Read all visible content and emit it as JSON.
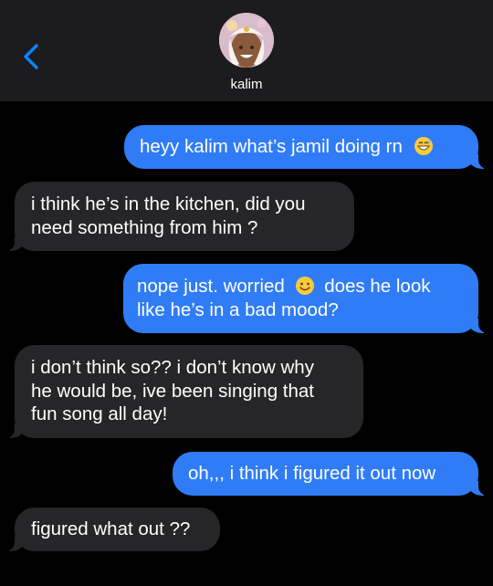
{
  "header": {
    "contact_name": "kalim",
    "back_icon": "chevron-left-icon",
    "avatar_icon": "contact-avatar"
  },
  "colors": {
    "outgoing_bubble": "#2f7cf6",
    "incoming_bubble": "#262628",
    "header_bg": "#1c1c1e",
    "accent": "#0a84ff"
  },
  "messages": [
    {
      "direction": "outgoing",
      "text": "heyy kalim what’s jamil doing rn",
      "emoji_after": "grinning-sweat-emoji"
    },
    {
      "direction": "incoming",
      "line1": "i think he’s in the kitchen, did you",
      "line2": "need something from him ?"
    },
    {
      "direction": "outgoing",
      "line1a": "nope just. worried",
      "emoji_mid": "smiling-face-emoji",
      "line1b": "does he look",
      "line2": "like he’s in a bad mood?"
    },
    {
      "direction": "incoming",
      "line1": "i don’t think so?? i don’t know why",
      "line2": "he would be, ive been singing that",
      "line3": "fun song all day!"
    },
    {
      "direction": "outgoing",
      "text": "oh,,, i think i figured it out now"
    },
    {
      "direction": "incoming",
      "text": "figured what out ??"
    }
  ]
}
